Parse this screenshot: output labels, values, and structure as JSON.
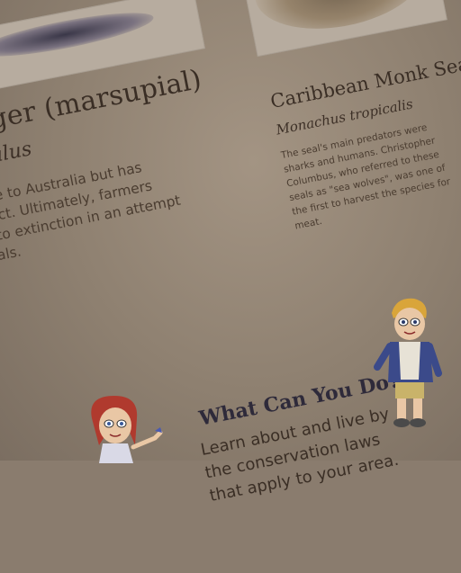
{
  "left_article": {
    "title": "Tiger (marsupial)",
    "scientific_name": "cephalus",
    "body_lines": [
      "native to Australia but has",
      "extinct. Ultimately, farmers",
      "pial to extinction in an attempt",
      "nimals."
    ]
  },
  "right_article": {
    "title": "Caribbean Monk Sea",
    "scientific_name": "Monachus tropicalis",
    "body_lines": [
      "The seal's main predators were",
      "sharks and humans. Christopher",
      "Columbus, who referred to these",
      "seals as \"sea wolves\", was one of",
      "the first to harvest the species for",
      "meat."
    ]
  },
  "action": {
    "heading": "What Can You Do?",
    "body_lines": [
      "Learn about and live by",
      "the conservation laws",
      "that apply to your area."
    ]
  }
}
